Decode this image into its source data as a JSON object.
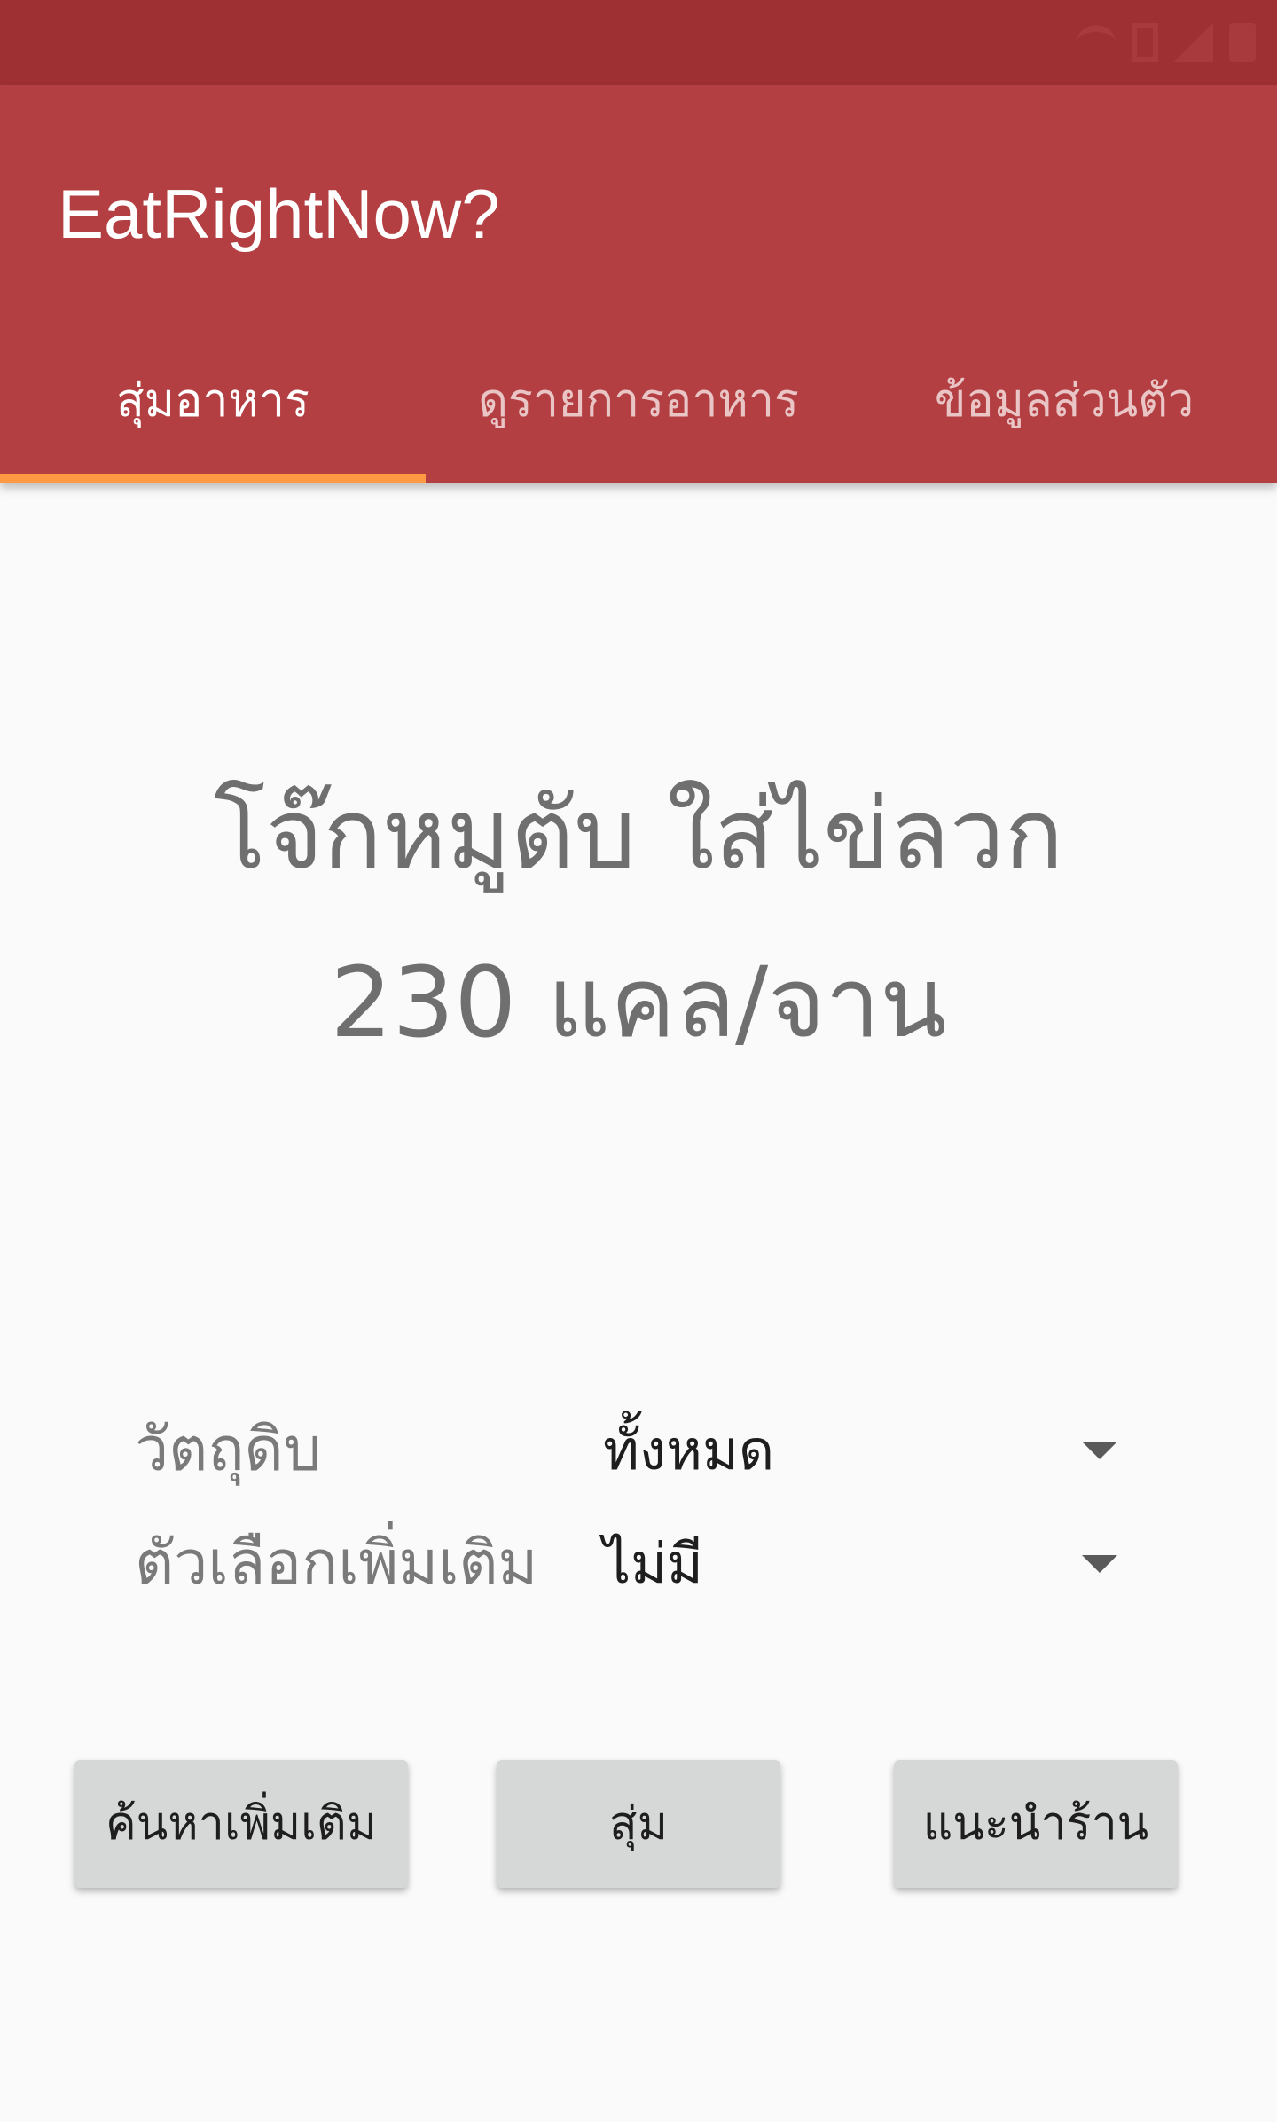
{
  "app": {
    "title": "EatRightNow?"
  },
  "tabs": [
    {
      "label": "สุ่มอาหาร"
    },
    {
      "label": "ดูรายการอาหาร"
    },
    {
      "label": "ข้อมูลส่วนตัว"
    }
  ],
  "result": {
    "food_name": "โจ๊กหมูตับ ใส่ไข่ลวก",
    "calories": "230 แคล/จาน"
  },
  "filters": {
    "ingredient_label": "วัตถุดิบ",
    "ingredient_value": "ทั้งหมด",
    "option_label": "ตัวเลือกเพิ่มเติม",
    "option_value": "ไม่มี"
  },
  "buttons": {
    "search_more": "ค้นหาเพิ่มเติม",
    "random": "สุ่ม",
    "recommend_shop": "แนะนำร้าน"
  },
  "colors": {
    "status_bar": "#9e3034",
    "app_bar": "#b43f42",
    "tab_indicator": "#ff9944",
    "button": "#d6d7d7"
  },
  "icons": {
    "status": [
      "sim-icon",
      "wifi-icon",
      "signal-icon",
      "battery-icon"
    ],
    "dropdown": "caret-down-icon"
  }
}
